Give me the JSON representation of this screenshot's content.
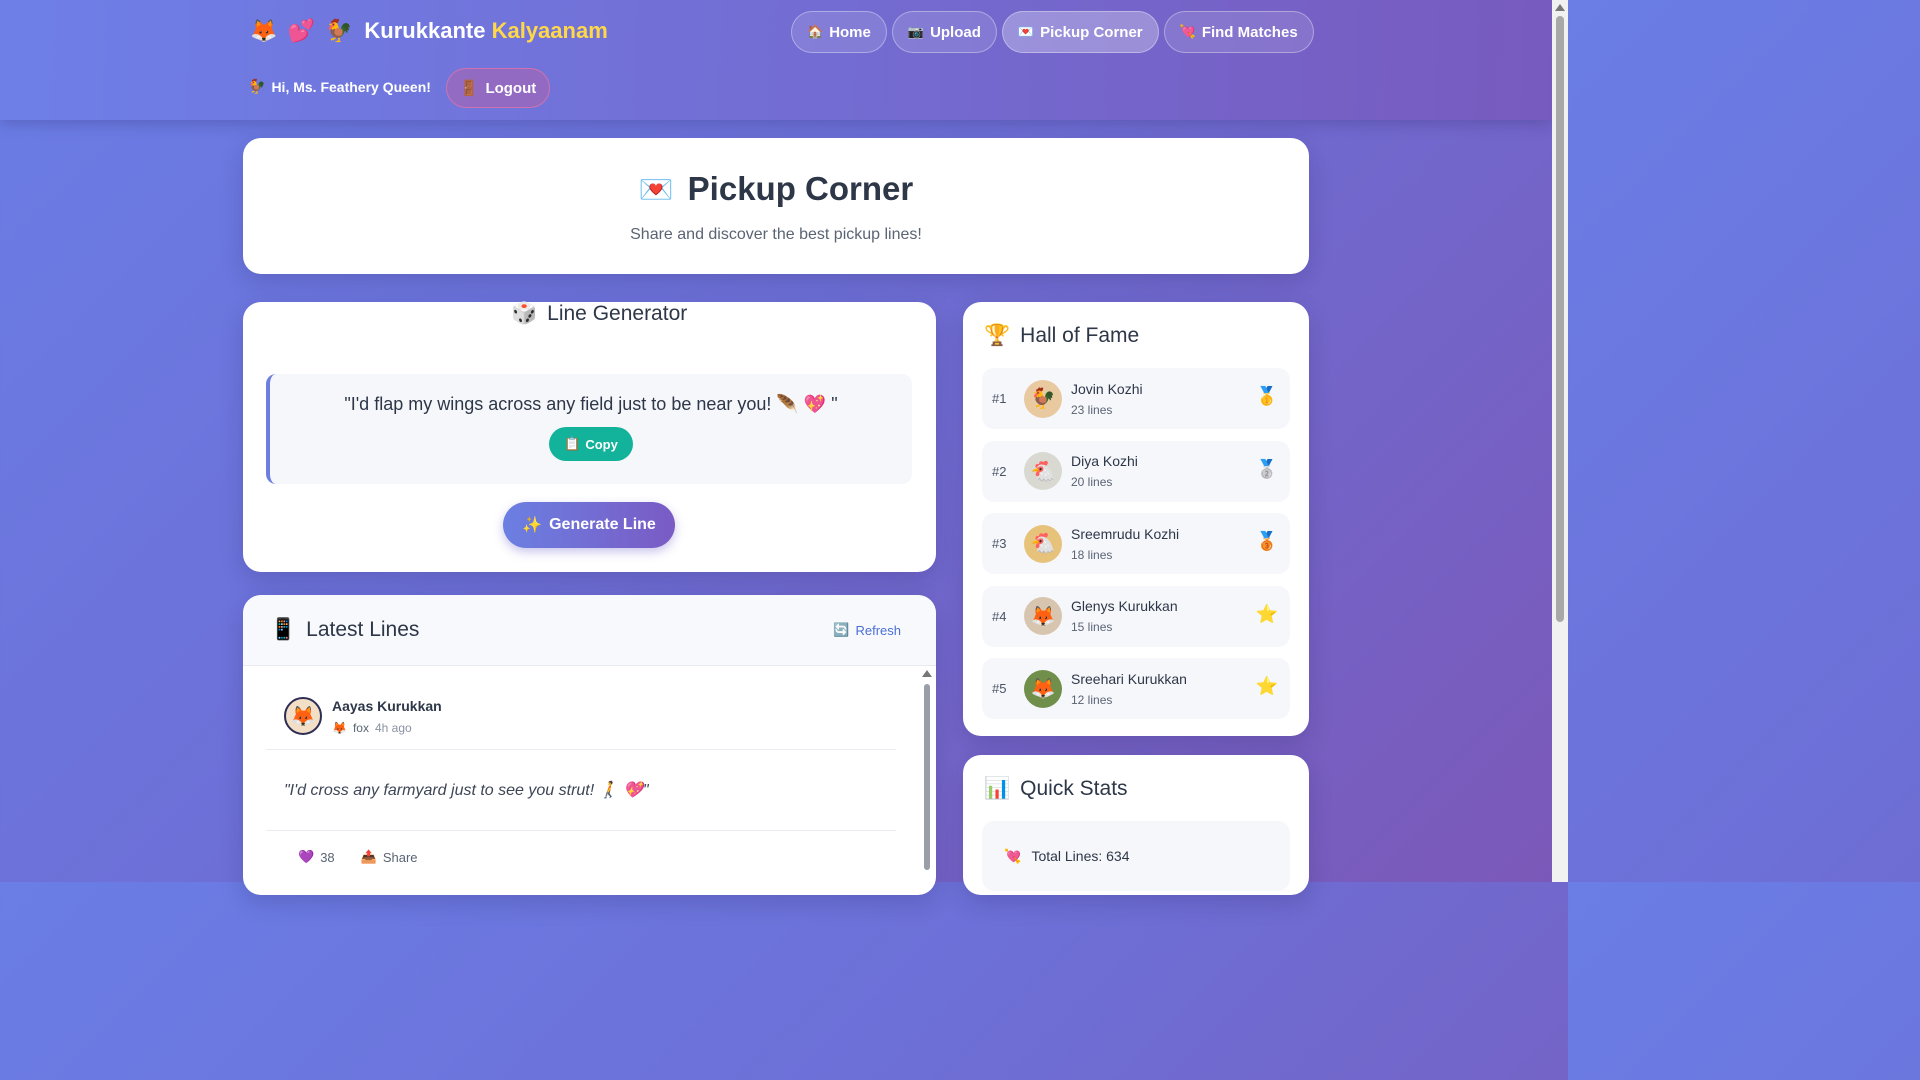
{
  "header": {
    "brand_emoji": "🦊 💕 🐓",
    "brand_name_1": "Kurukkante",
    "brand_name_2": "Kalyaanam",
    "nav": [
      {
        "icon": "🏠",
        "label": "Home"
      },
      {
        "icon": "📷",
        "label": "Upload"
      },
      {
        "icon": "💌",
        "label": "Pickup Corner"
      },
      {
        "icon": "💘",
        "label": "Find Matches"
      }
    ],
    "greeting_icon": "🐓",
    "greeting": "Hi, Ms. Feathery Queen!",
    "logout_icon": "🚪",
    "logout_label": "Logout"
  },
  "hero": {
    "icon": "💌",
    "title": "Pickup Corner",
    "subtitle": "Share and discover the best pickup lines!"
  },
  "generator": {
    "icon": "🎲",
    "title": "Line Generator",
    "line": "\"I'd flap my wings across any field just to be near you! 🪶 💖 \"",
    "copy_icon": "📋",
    "copy_label": "Copy",
    "generate_icon": "✨",
    "generate_label": "Generate Line"
  },
  "latest": {
    "icon": "📱",
    "title": "Latest Lines",
    "refresh_icon": "🔄",
    "refresh_label": "Refresh",
    "posts": [
      {
        "author": "Aayas Kurukkan",
        "avatar": "🦊",
        "species_icon": "🦊",
        "species": "fox",
        "time": "4h ago",
        "text": "\"I'd cross any farmyard just to see you strut! 🚶 💖\"",
        "likes_icon": "💜",
        "likes": "38",
        "share_icon": "📤",
        "share_label": "Share"
      }
    ]
  },
  "hall_of_fame": {
    "icon": "🏆",
    "title": "Hall of Fame",
    "entries": [
      {
        "rank": "#1",
        "avatar": "🐓",
        "name": "Jovin Kozhi",
        "count": "23 lines",
        "medal": "🥇"
      },
      {
        "rank": "#2",
        "avatar": "🐔",
        "name": "Diya Kozhi",
        "count": "20 lines",
        "medal": "🥈"
      },
      {
        "rank": "#3",
        "avatar": "🐔",
        "name": "Sreemrudu Kozhi",
        "count": "18 lines",
        "medal": "🥉"
      },
      {
        "rank": "#4",
        "avatar": "🦊",
        "name": "Glenys Kurukkan",
        "count": "15 lines",
        "medal": "⭐"
      },
      {
        "rank": "#5",
        "avatar": "🦊",
        "name": "Sreehari Kurukkan",
        "count": "12 lines",
        "medal": "⭐"
      }
    ]
  },
  "stats": {
    "icon": "📊",
    "title": "Quick Stats",
    "items": [
      {
        "icon": "💘",
        "label": "Total Lines: 634"
      }
    ]
  }
}
